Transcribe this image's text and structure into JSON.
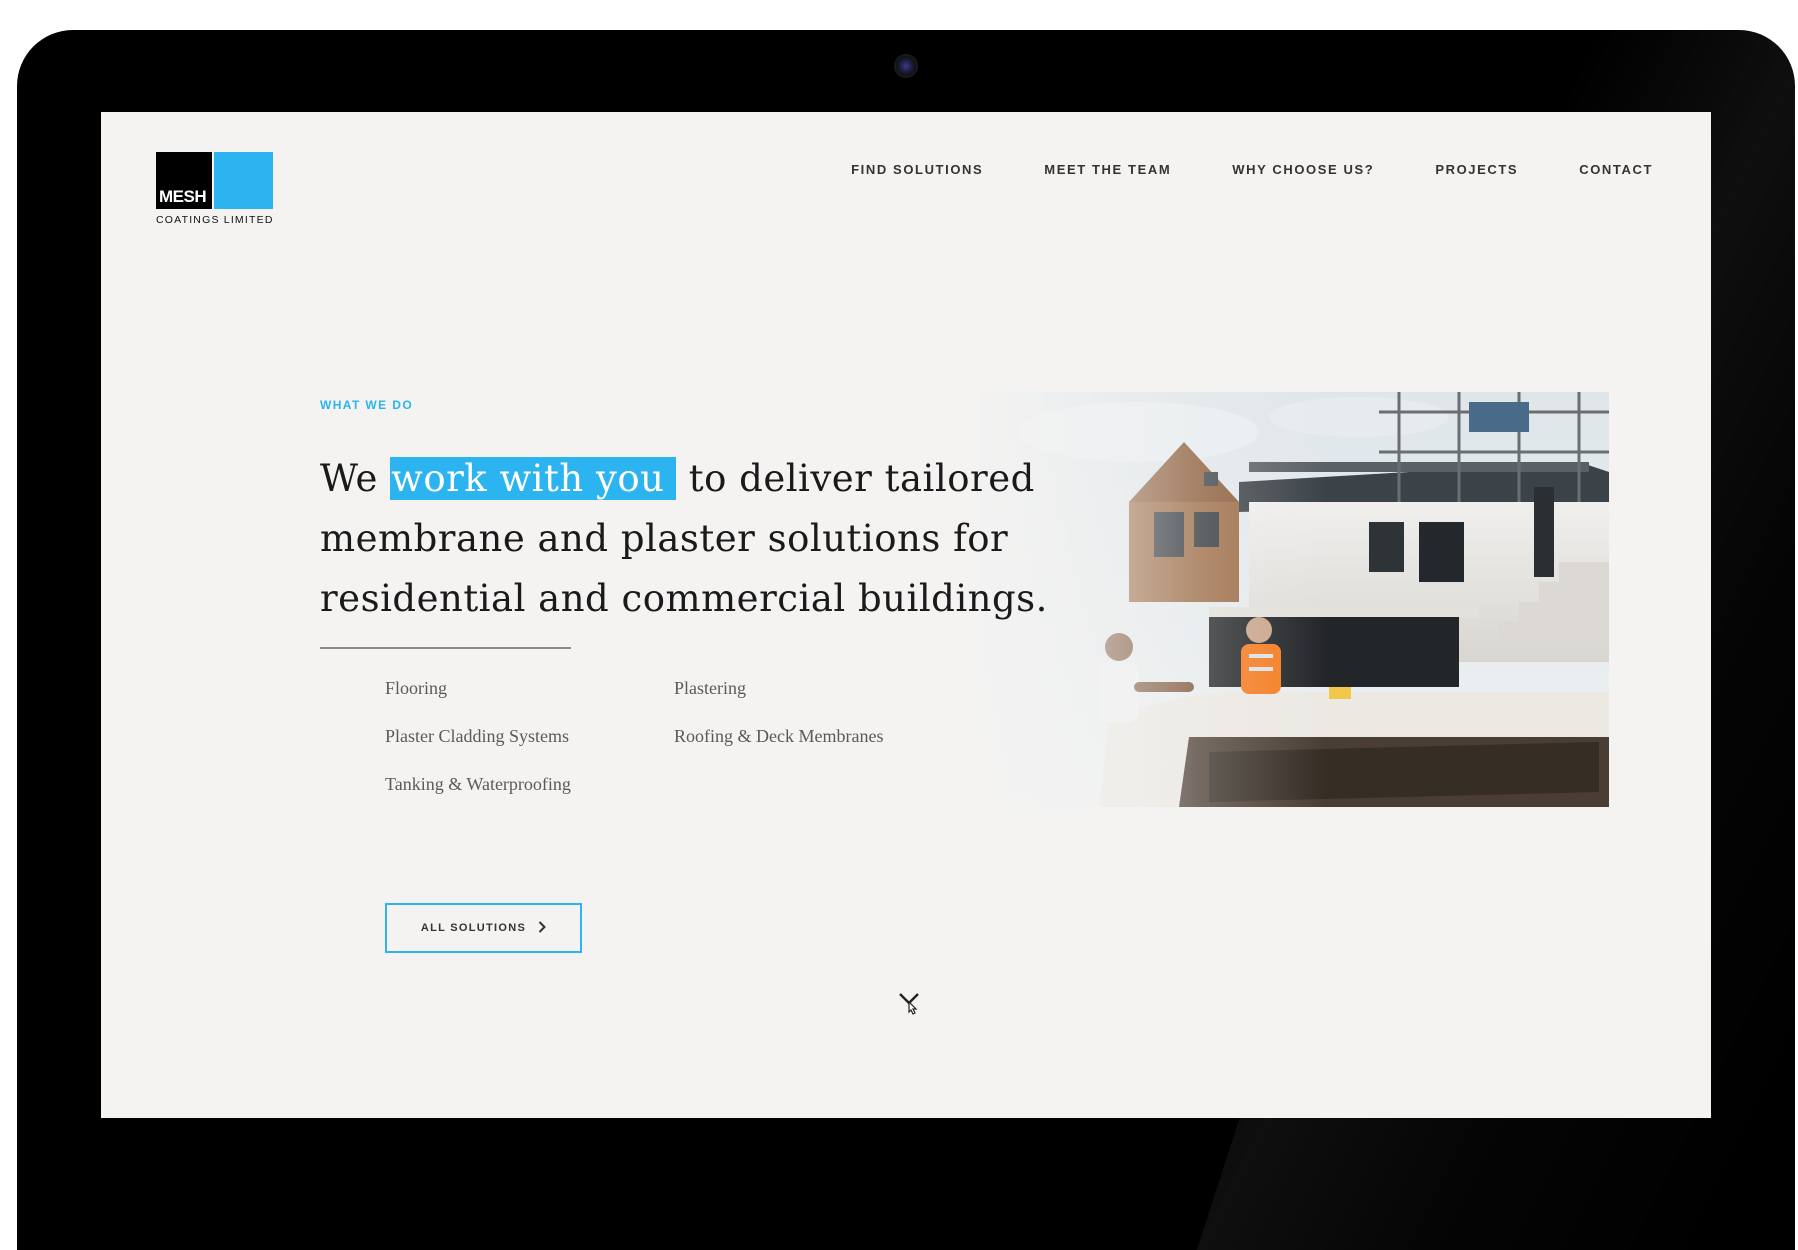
{
  "brand": {
    "logo_mark": "MESH",
    "logo_subtitle": "COATINGS LIMITED",
    "accent_color": "#2bb4f0"
  },
  "nav": {
    "items": [
      {
        "label": "FIND SOLUTIONS"
      },
      {
        "label": "MEET THE TEAM"
      },
      {
        "label": "WHY CHOOSE US?"
      },
      {
        "label": "PROJECTS"
      },
      {
        "label": "CONTACT"
      }
    ]
  },
  "section": {
    "eyebrow": "WHAT WE DO",
    "headline_pre": "We ",
    "headline_highlight": "work with you",
    "headline_post": " to deliver tailored membrane and plaster solutions for residential and commercial buildings.",
    "solutions": [
      "Flooring",
      "Plastering",
      "Plaster Cladding Systems",
      "Roofing & Deck Membranes",
      "Tanking & Waterproofing"
    ],
    "button_label": "ALL SOLUTIONS",
    "button_icon": "chevron-right-icon",
    "photo_icon": "construction-site-photo",
    "scroll_icon": "scroll-down-icon"
  }
}
